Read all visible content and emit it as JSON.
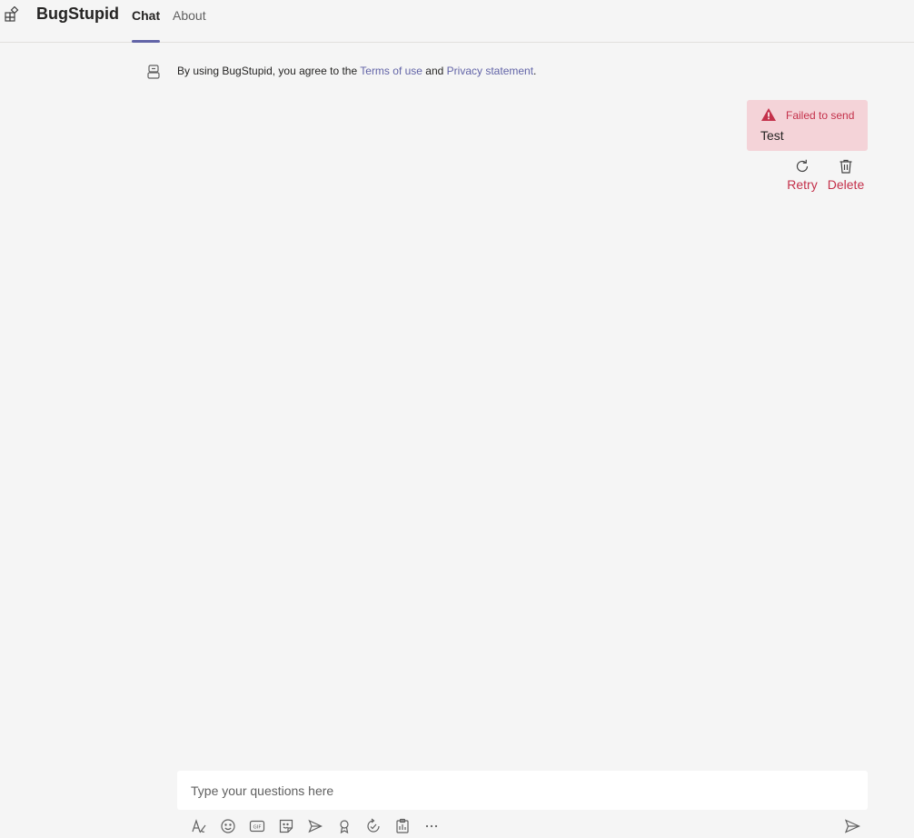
{
  "header": {
    "app_title": "BugStupid",
    "tabs": [
      {
        "label": "Chat",
        "active": true
      },
      {
        "label": "About",
        "active": false
      }
    ],
    "app_icon": "apps-icon"
  },
  "notice": {
    "prefix": "By using BugStupid, you agree to the ",
    "terms_link": "Terms of use",
    "middle": " and ",
    "privacy_link": "Privacy statement",
    "suffix": ".",
    "icon": "bot-icon"
  },
  "message": {
    "status": "Failed to send",
    "text": "Test",
    "status_icon": "warning-icon",
    "actions": [
      {
        "label": "Retry",
        "icon": "retry-icon"
      },
      {
        "label": "Delete",
        "icon": "trash-icon"
      }
    ]
  },
  "composer": {
    "placeholder": "Type your questions here",
    "toolbar": [
      "format-icon",
      "emoji-icon",
      "gif-icon",
      "sticker-icon",
      "meet-icon",
      "praise-icon",
      "loop-icon",
      "forms-icon",
      "more-icon"
    ],
    "send_icon": "send-icon"
  },
  "colors": {
    "accent": "#6264a7",
    "error": "#c4314b",
    "error_bg": "#f4d3d8",
    "background": "#f5f5f5"
  }
}
